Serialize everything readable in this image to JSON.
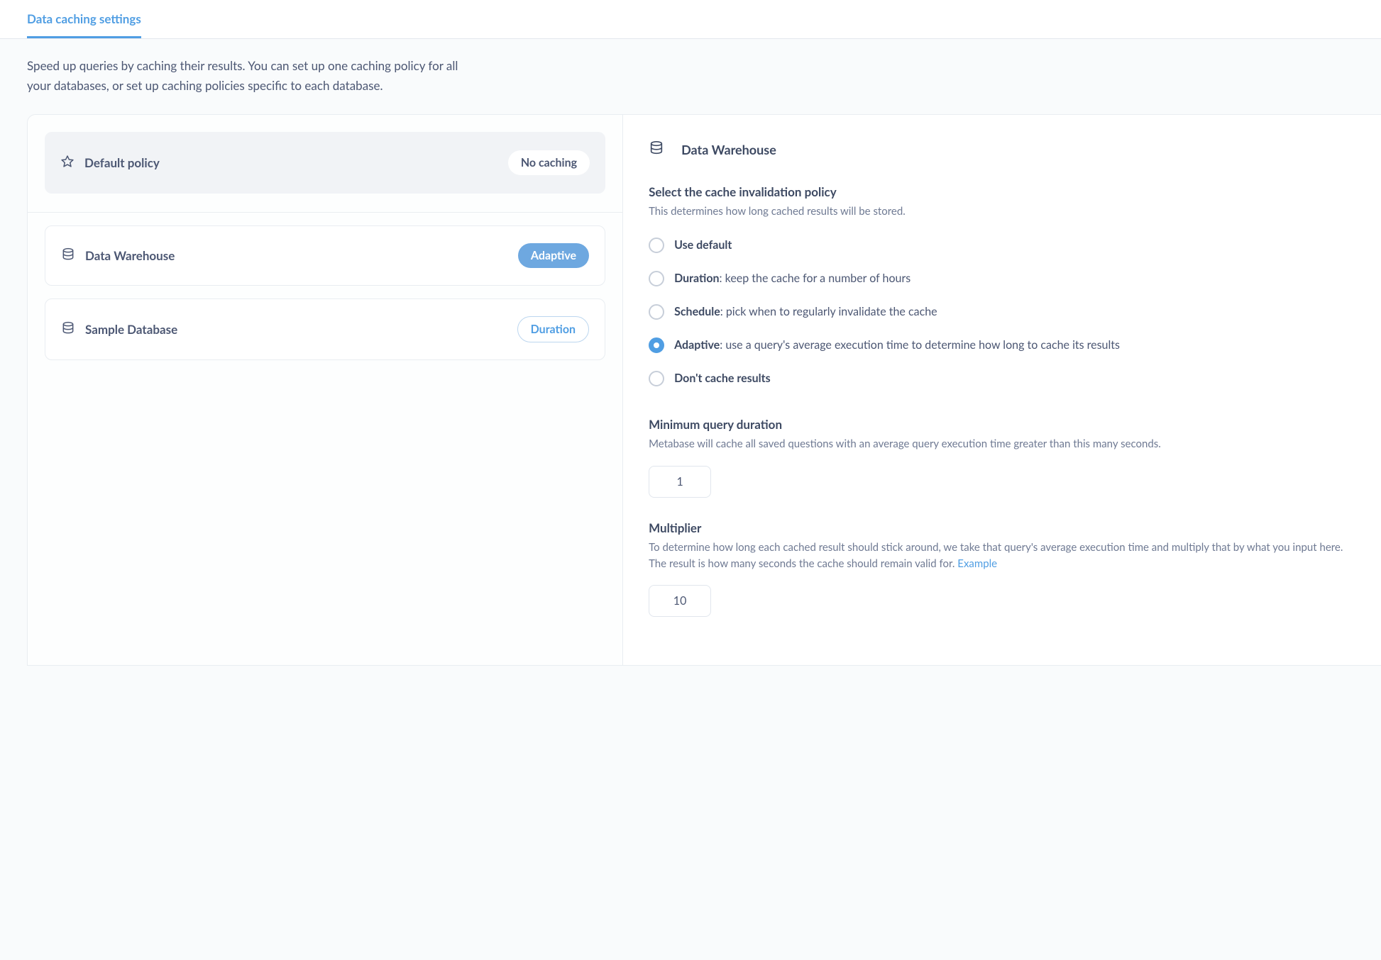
{
  "tab": {
    "label": "Data caching settings"
  },
  "intro": "Speed up queries by caching their results. You can set up one caching policy for all your databases, or set up caching policies specific to each database.",
  "default_policy": {
    "label": "Default policy",
    "badge": "No caching"
  },
  "databases": [
    {
      "name": "Data Warehouse",
      "badge": "Adaptive",
      "badge_style": "blue-solid"
    },
    {
      "name": "Sample Database",
      "badge": "Duration",
      "badge_style": "blue-outline"
    }
  ],
  "detail": {
    "title": "Data Warehouse",
    "policy_heading": "Select the cache invalidation policy",
    "policy_sub": "This determines how long cached results will be stored.",
    "options": {
      "use_default": {
        "bold": "Use default",
        "rest": ""
      },
      "duration": {
        "bold": "Duration",
        "rest": ": keep the cache for a number of hours"
      },
      "schedule": {
        "bold": "Schedule",
        "rest": ": pick when to regularly invalidate the cache"
      },
      "adaptive": {
        "bold": "Adaptive",
        "rest": ": use a query's average execution time to determine how long to cache its results"
      },
      "nocache": {
        "bold": "Don't cache results",
        "rest": ""
      }
    },
    "selected": "adaptive",
    "min_duration": {
      "heading": "Minimum query duration",
      "desc": "Metabase will cache all saved questions with an average query execution time greater than this many seconds.",
      "value": "1"
    },
    "multiplier": {
      "heading": "Multiplier",
      "desc": "To determine how long each cached result should stick around, we take that query's average execution time and multiply that by what you input here. The result is how many seconds the cache should remain valid for. ",
      "link": "Example",
      "value": "10"
    }
  }
}
